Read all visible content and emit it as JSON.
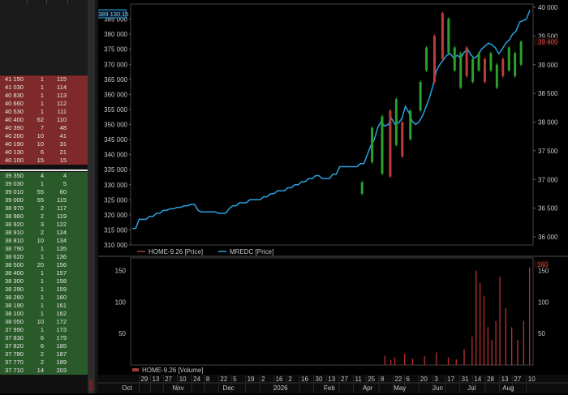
{
  "order_book": {
    "asks": [
      {
        "price": "41 150",
        "qty": "1",
        "count": "115"
      },
      {
        "price": "41 030",
        "qty": "1",
        "count": "114"
      },
      {
        "price": "40 830",
        "qty": "1",
        "count": "113"
      },
      {
        "price": "40 660",
        "qty": "1",
        "count": "112"
      },
      {
        "price": "40 530",
        "qty": "1",
        "count": "111"
      },
      {
        "price": "40 400",
        "qty": "62",
        "count": "110"
      },
      {
        "price": "40 390",
        "qty": "7",
        "count": "48"
      },
      {
        "price": "40 200",
        "qty": "10",
        "count": "41"
      },
      {
        "price": "40 190",
        "qty": "10",
        "count": "31"
      },
      {
        "price": "40 130",
        "qty": "6",
        "count": "21"
      },
      {
        "price": "40 100",
        "qty": "15",
        "count": "15"
      }
    ],
    "bids": [
      {
        "price": "39 350",
        "qty": "4",
        "count": "4"
      },
      {
        "price": "39 030",
        "qty": "1",
        "count": "5"
      },
      {
        "price": "39 010",
        "qty": "55",
        "count": "60"
      },
      {
        "price": "39 000",
        "qty": "55",
        "count": "115"
      },
      {
        "price": "38 970",
        "qty": "2",
        "count": "117"
      },
      {
        "price": "38 960",
        "qty": "2",
        "count": "119"
      },
      {
        "price": "38 920",
        "qty": "3",
        "count": "122"
      },
      {
        "price": "38 910",
        "qty": "2",
        "count": "124"
      },
      {
        "price": "38 810",
        "qty": "10",
        "count": "134"
      },
      {
        "price": "38 790",
        "qty": "1",
        "count": "135"
      },
      {
        "price": "38 620",
        "qty": "1",
        "count": "136"
      },
      {
        "price": "38 500",
        "qty": "20",
        "count": "156"
      },
      {
        "price": "38 400",
        "qty": "1",
        "count": "157"
      },
      {
        "price": "38 300",
        "qty": "1",
        "count": "158"
      },
      {
        "price": "38 290",
        "qty": "1",
        "count": "159"
      },
      {
        "price": "38 260",
        "qty": "1",
        "count": "160"
      },
      {
        "price": "38 190",
        "qty": "1",
        "count": "161"
      },
      {
        "price": "38 100",
        "qty": "1",
        "count": "162"
      },
      {
        "price": "38 050",
        "qty": "10",
        "count": "172"
      },
      {
        "price": "37 990",
        "qty": "1",
        "count": "173"
      },
      {
        "price": "37 830",
        "qty": "6",
        "count": "179"
      },
      {
        "price": "37 820",
        "qty": "6",
        "count": "185"
      },
      {
        "price": "37 780",
        "qty": "2",
        "count": "187"
      },
      {
        "price": "37 770",
        "qty": "2",
        "count": "189"
      },
      {
        "price": "37 710",
        "qty": "14",
        "count": "203"
      }
    ]
  },
  "chart": {
    "left_axis_ticks": [
      "385 000",
      "380 000",
      "375 000",
      "370 000",
      "365 000",
      "360 000",
      "355 000",
      "350 000",
      "345 000",
      "340 000",
      "335 000",
      "330 000",
      "325 000",
      "320 000",
      "315 000",
      "310 000"
    ],
    "left_axis_values": [
      385000,
      380000,
      375000,
      370000,
      365000,
      360000,
      355000,
      350000,
      345000,
      340000,
      335000,
      330000,
      325000,
      320000,
      315000,
      310000
    ],
    "right_axis_ticks": [
      "40 000",
      "39 500",
      "39 000",
      "38 500",
      "38 000",
      "37 500",
      "37 000",
      "36 500",
      "36 000"
    ],
    "right_axis_values": [
      40000,
      39500,
      39000,
      38500,
      38000,
      37500,
      37000,
      36500,
      36000
    ],
    "left_cursor_label": "389 130,15",
    "right_cursor_label": "39 400",
    "legend": [
      {
        "label": "HOME-9.26 [Price]",
        "color": "#a33a3a"
      },
      {
        "label": "MREDC [Price]",
        "color": "#2aa0e0"
      }
    ],
    "volume_ticks": [
      "150",
      "100",
      "50"
    ],
    "volume_tick_values": [
      150,
      100,
      50
    ],
    "volume_cursor_label": "160",
    "volume_legend": {
      "label": "HOME-9.26 [Volume]",
      "color": "#a33a3a"
    },
    "day_ticks": [
      {
        "label": "29",
        "pos": 0.03
      },
      {
        "label": "13",
        "pos": 0.07
      },
      {
        "label": "27",
        "pos": 0.115
      },
      {
        "label": "10",
        "pos": 0.165
      },
      {
        "label": "24",
        "pos": 0.215
      },
      {
        "label": "8",
        "pos": 0.26
      },
      {
        "label": "22",
        "pos": 0.31
      },
      {
        "label": "5",
        "pos": 0.355
      },
      {
        "label": "19",
        "pos": 0.405
      },
      {
        "label": "2",
        "pos": 0.455
      },
      {
        "label": "16",
        "pos": 0.505
      },
      {
        "label": "2",
        "pos": 0.55
      },
      {
        "label": "16",
        "pos": 0.595
      },
      {
        "label": "30",
        "pos": 0.645
      },
      {
        "label": "13",
        "pos": 0.69
      },
      {
        "label": "27",
        "pos": 0.735
      },
      {
        "label": "11",
        "pos": 0.785
      },
      {
        "label": "25",
        "pos": 0.83
      },
      {
        "label": "8",
        "pos": 0.875
      },
      {
        "label": "22",
        "pos": 0.925
      },
      {
        "label": "6",
        "pos": 0.965
      },
      {
        "label": "20",
        "pos": 1.015
      },
      {
        "label": "3",
        "pos": 1.065
      },
      {
        "label": "17",
        "pos": 1.11
      },
      {
        "label": "31",
        "pos": 1.16
      },
      {
        "label": "14",
        "pos": 1.205
      },
      {
        "label": "28",
        "pos": 1.25
      },
      {
        "label": "13",
        "pos": 1.3
      },
      {
        "label": "27",
        "pos": 1.345
      },
      {
        "label": "10",
        "pos": 1.395
      }
    ],
    "month_ticks": [
      {
        "label": "Oct",
        "pos": 0.04
      },
      {
        "label": "Nov",
        "pos": 0.17
      },
      {
        "label": "Dec",
        "pos": 0.3
      },
      {
        "label": "2026",
        "pos": 0.43
      },
      {
        "label": "Feb",
        "pos": 0.56
      },
      {
        "label": "Apr",
        "pos": 0.66
      },
      {
        "label": "May",
        "pos": 0.74
      },
      {
        "label": "Jun",
        "pos": 0.84
      },
      {
        "label": "Jul",
        "pos": 0.93
      },
      {
        "label": "Aug",
        "pos": 1.02
      }
    ],
    "series_color_up": "#2aa02a",
    "series_color_down": "#c03a3a",
    "line_color": "#2aa0e0"
  },
  "chart_data": {
    "type": "line",
    "series": [
      {
        "name": "MREDC [Price]",
        "axis": "left",
        "values": [
          315500,
          315500,
          318500,
          318500,
          318500,
          319500,
          319500,
          320500,
          320500,
          321500,
          321500,
          322000,
          322000,
          322500,
          322500,
          323000,
          323000,
          323500,
          323500,
          321500,
          321000,
          321000,
          321000,
          321000,
          321000,
          320500,
          320500,
          320500,
          322000,
          323000,
          323000,
          324000,
          324000,
          324000,
          325000,
          325000,
          325000,
          325000,
          326000,
          326000,
          327000,
          327000,
          328000,
          328000,
          328000,
          329000,
          329000,
          330000,
          330000,
          331000,
          331000,
          332000,
          332000,
          333000,
          333000,
          332000,
          332000,
          332000,
          333500,
          333500,
          336000,
          336000,
          336000,
          336000,
          336000,
          336000,
          337000,
          337000,
          340000,
          343000,
          345000,
          349000,
          351000,
          349500,
          350000,
          352000,
          350000,
          350500,
          352000,
          356000,
          354000,
          351000,
          350000,
          351000,
          353000,
          356000,
          359000,
          363000,
          368000,
          370000,
          371500,
          373000,
          373500,
          372000,
          373000,
          372000,
          374000,
          375000,
          373000,
          372000,
          373000,
          375000,
          376000,
          377000,
          376500,
          375500,
          373500,
          375000,
          377000,
          378000,
          380000,
          381000,
          384000,
          384500,
          385000,
          388000
        ]
      },
      {
        "name": "HOME-9.26 [Price]",
        "axis": "right",
        "type": "candles"
      }
    ],
    "ylim_left": [
      310000,
      390000
    ],
    "ylim_right": [
      36000,
      40000
    ]
  }
}
